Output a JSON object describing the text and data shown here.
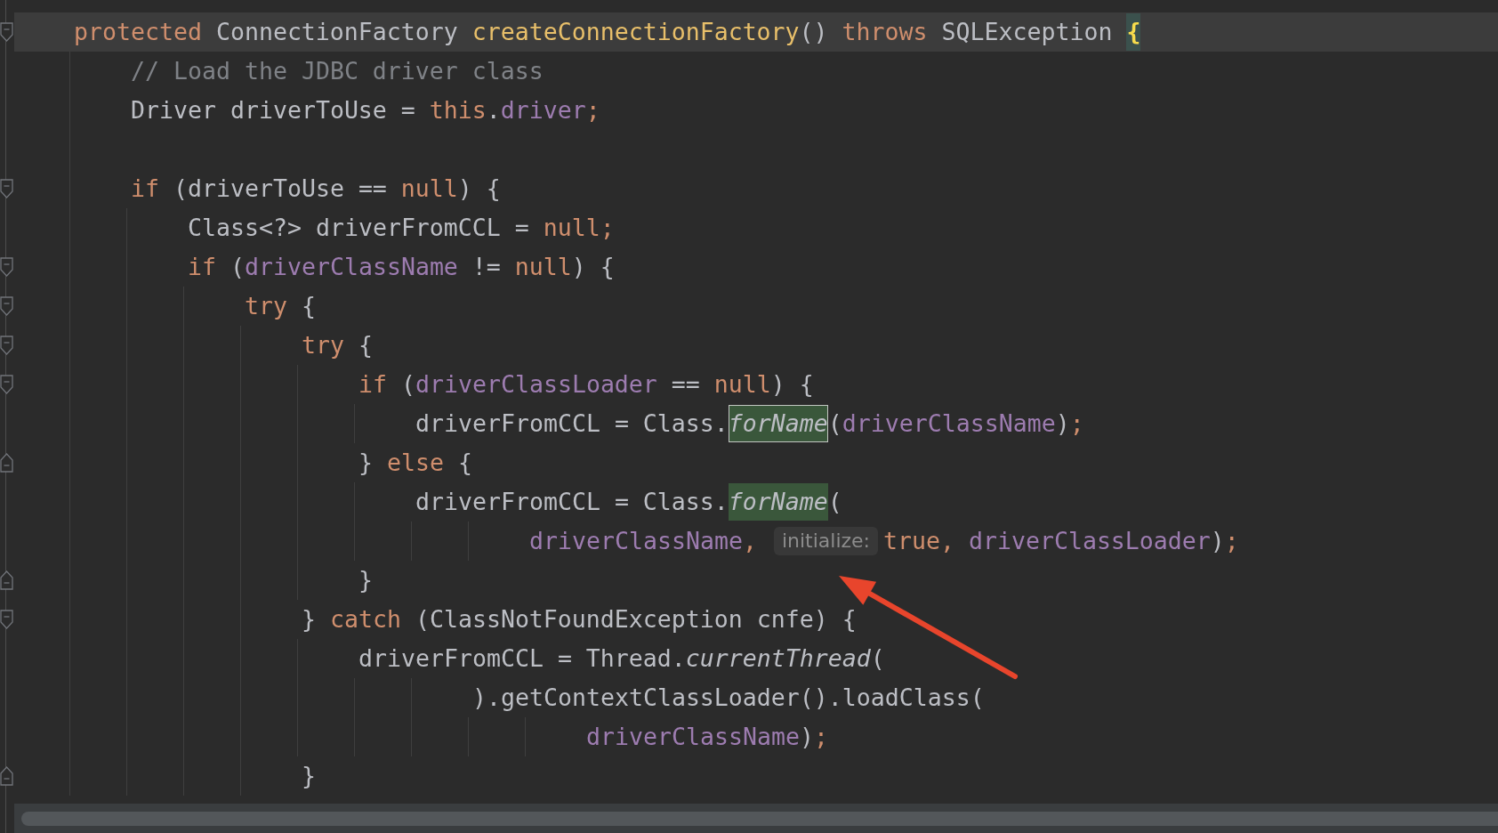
{
  "editor": {
    "lines": [
      {
        "kind": "fold_start",
        "current": true,
        "tokens": [
          {
            "kind": "keyword",
            "text": "protected "
          },
          {
            "kind": "text",
            "text": "ConnectionFactory "
          },
          {
            "kind": "declaration",
            "text": "createConnectionFactory"
          },
          {
            "kind": "text",
            "text": "() "
          },
          {
            "kind": "keyword",
            "text": "throws "
          },
          {
            "kind": "text",
            "text": "SQLException "
          },
          {
            "kind": "brace_match",
            "text": "{"
          }
        ]
      },
      {
        "kind": "plain",
        "current": false,
        "tokens": [
          {
            "kind": "comment",
            "text": "    // Load the JDBC driver class"
          }
        ]
      },
      {
        "kind": "plain",
        "current": false,
        "tokens": [
          {
            "kind": "text",
            "text": "    Driver driverToUse = "
          },
          {
            "kind": "keyword",
            "text": "this"
          },
          {
            "kind": "text",
            "text": "."
          },
          {
            "kind": "field",
            "text": "driver"
          },
          {
            "kind": "punct",
            "text": ";"
          }
        ]
      },
      {
        "kind": "blank",
        "current": false
      },
      {
        "kind": "fold_start",
        "current": false,
        "tokens": [
          {
            "kind": "keyword",
            "text": "    if "
          },
          {
            "kind": "text",
            "text": "(driverToUse == "
          },
          {
            "kind": "keyword",
            "text": "null"
          },
          {
            "kind": "text",
            "text": ") {"
          }
        ]
      },
      {
        "kind": "plain",
        "current": false,
        "tokens": [
          {
            "kind": "text",
            "text": "        Class<?> driverFromCCL = "
          },
          {
            "kind": "keyword",
            "text": "null"
          },
          {
            "kind": "punct",
            "text": ";"
          }
        ]
      },
      {
        "kind": "fold_start",
        "current": false,
        "tokens": [
          {
            "kind": "keyword",
            "text": "        if "
          },
          {
            "kind": "text",
            "text": "("
          },
          {
            "kind": "field",
            "text": "driverClassName"
          },
          {
            "kind": "text",
            "text": " != "
          },
          {
            "kind": "keyword",
            "text": "null"
          },
          {
            "kind": "text",
            "text": ") {"
          }
        ]
      },
      {
        "kind": "fold_start",
        "current": false,
        "tokens": [
          {
            "kind": "keyword",
            "text": "            try "
          },
          {
            "kind": "text",
            "text": "{"
          }
        ]
      },
      {
        "kind": "fold_start",
        "current": false,
        "tokens": [
          {
            "kind": "keyword",
            "text": "                try "
          },
          {
            "kind": "text",
            "text": "{"
          }
        ]
      },
      {
        "kind": "fold_start",
        "current": false,
        "tokens": [
          {
            "kind": "keyword",
            "text": "                    if "
          },
          {
            "kind": "text",
            "text": "("
          },
          {
            "kind": "field",
            "text": "driverClassLoader"
          },
          {
            "kind": "text",
            "text": " == "
          },
          {
            "kind": "keyword",
            "text": "null"
          },
          {
            "kind": "text",
            "text": ") {"
          }
        ]
      },
      {
        "kind": "plain",
        "current": false,
        "tokens": [
          {
            "kind": "text",
            "text": "                        driverFromCCL = Class."
          },
          {
            "kind": "usage_outlined",
            "text": "forName"
          },
          {
            "kind": "text",
            "text": "("
          },
          {
            "kind": "field",
            "text": "driverClassName"
          },
          {
            "kind": "text",
            "text": ")"
          },
          {
            "kind": "punct",
            "text": ";"
          }
        ]
      },
      {
        "kind": "fold_end",
        "current": false,
        "tokens": [
          {
            "kind": "text",
            "text": "                    } "
          },
          {
            "kind": "keyword",
            "text": "else "
          },
          {
            "kind": "text",
            "text": "{"
          }
        ]
      },
      {
        "kind": "plain",
        "current": false,
        "tokens": [
          {
            "kind": "text",
            "text": "                        driverFromCCL = Class."
          },
          {
            "kind": "usage",
            "text": "forName"
          },
          {
            "kind": "text",
            "text": "("
          }
        ]
      },
      {
        "kind": "plain",
        "current": false,
        "tokens": [
          {
            "kind": "field",
            "text": "                                driverClassName"
          },
          {
            "kind": "punct",
            "text": ","
          },
          {
            "kind": "hint",
            "text": "initialize:"
          },
          {
            "kind": "keyword",
            "text": "true"
          },
          {
            "kind": "punct",
            "text": ", "
          },
          {
            "kind": "field",
            "text": "driverClassLoader"
          },
          {
            "kind": "text",
            "text": ")"
          },
          {
            "kind": "punct",
            "text": ";"
          }
        ]
      },
      {
        "kind": "fold_end",
        "current": false,
        "tokens": [
          {
            "kind": "text",
            "text": "                    }"
          }
        ]
      },
      {
        "kind": "fold_start",
        "current": false,
        "tokens": [
          {
            "kind": "text",
            "text": "                } "
          },
          {
            "kind": "keyword",
            "text": "catch "
          },
          {
            "kind": "text",
            "text": "(ClassNotFoundException cnfe) {"
          }
        ]
      },
      {
        "kind": "plain",
        "current": false,
        "tokens": [
          {
            "kind": "text",
            "text": "                    driverFromCCL = Thread."
          },
          {
            "kind": "static_call",
            "text": "currentThread"
          },
          {
            "kind": "text",
            "text": "("
          }
        ]
      },
      {
        "kind": "plain",
        "current": false,
        "tokens": [
          {
            "kind": "text",
            "text": "                            ).getContextClassLoader().loadClass("
          }
        ]
      },
      {
        "kind": "plain",
        "current": false,
        "tokens": [
          {
            "kind": "field",
            "text": "                                    driverClassName"
          },
          {
            "kind": "text",
            "text": ")"
          },
          {
            "kind": "punct",
            "text": ";"
          }
        ]
      },
      {
        "kind": "fold_end",
        "current": false,
        "tokens": [
          {
            "kind": "text",
            "text": "                }"
          }
        ]
      }
    ]
  },
  "annotations": [
    {
      "kind": "arrow"
    }
  ]
}
